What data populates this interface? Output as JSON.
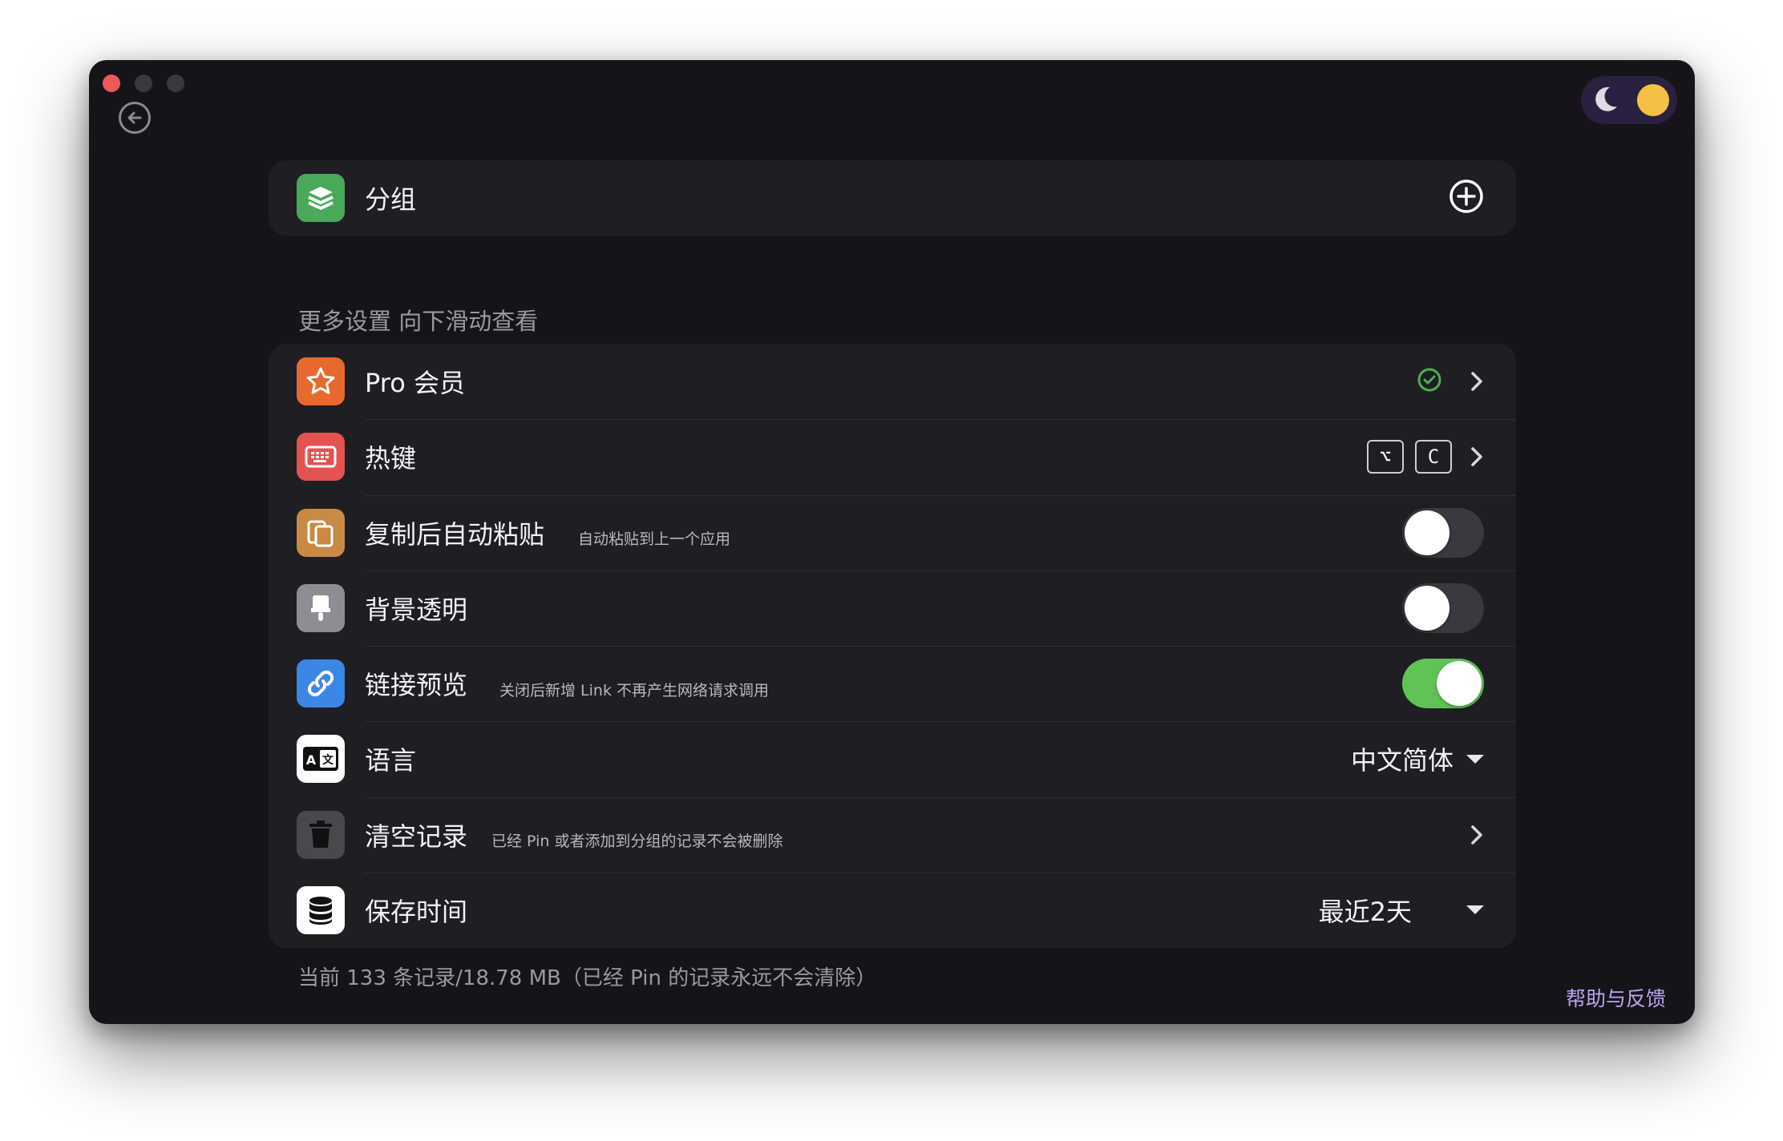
{
  "window": {
    "traffic_lights": [
      "close",
      "minimize",
      "maximize"
    ]
  },
  "header": {
    "back_icon": "back-arrow-icon",
    "theme_icons": [
      "moon-icon",
      "sun-icon"
    ]
  },
  "group_card": {
    "label": "分组",
    "icon": "layers-icon",
    "action_icon": "plus-circle-icon"
  },
  "section_title": "更多设置 向下滑动查看",
  "settings": {
    "pro": {
      "label": "Pro 会员",
      "icon": "star-icon",
      "status_icon": "check-circle-icon"
    },
    "hotkey": {
      "label": "热键",
      "icon": "keyboard-icon",
      "keys": [
        "⌥",
        "C"
      ]
    },
    "auto_paste": {
      "label": "复制后自动粘贴",
      "sub": "自动粘贴到上一个应用",
      "icon": "copy-icon",
      "enabled": false
    },
    "transparent_bg": {
      "label": "背景透明",
      "icon": "brush-icon",
      "enabled": false
    },
    "link_preview": {
      "label": "链接预览",
      "sub": "关闭后新增 Link 不再产生网络请求调用",
      "icon": "link-icon",
      "enabled": true
    },
    "language": {
      "label": "语言",
      "icon": "translate-icon",
      "value": "中文简体"
    },
    "clear_history": {
      "label": "清空记录",
      "sub": "已经 Pin 或者添加到分组的记录不会被删除",
      "icon": "trash-icon"
    },
    "retention": {
      "label": "保存时间",
      "icon": "database-icon",
      "value": "最近2天"
    }
  },
  "footer_note": "当前 133 条记录/18.78 MB（已经 Pin 的记录永远不会清除）",
  "help_link": "帮助与反馈",
  "colors": {
    "window_bg": "#161419",
    "card_bg": "#1f1e23",
    "toggle_on": "#61c354",
    "accent_link": "#b7a6f2",
    "check_green": "#4caf50"
  }
}
